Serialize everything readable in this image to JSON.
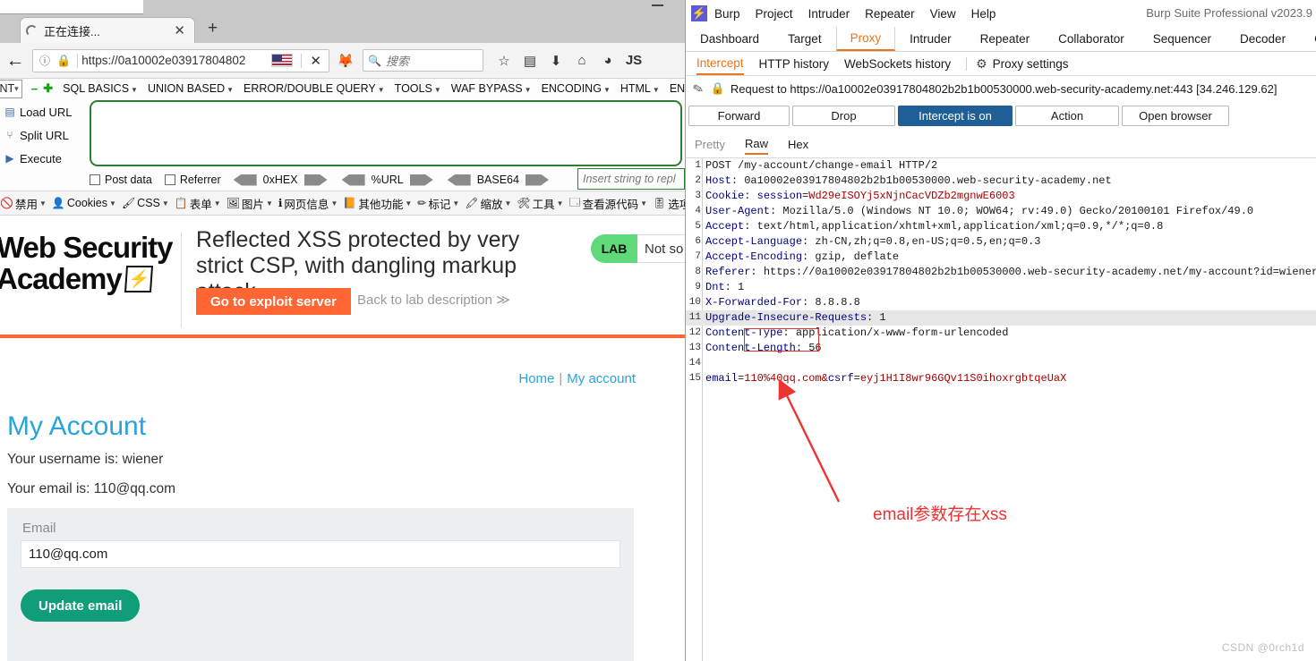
{
  "browser": {
    "tab": {
      "title": "正在连接...",
      "close": "✕",
      "new_tab": "+"
    },
    "url": "https://0a10002e03917804802",
    "search_placeholder": "搜索",
    "icons": [
      "info-icon",
      "lock-icon",
      "flag-us-icon",
      "stop-icon",
      "extension-icon",
      "search-icon",
      "bookmark-star-icon",
      "reader-icon",
      "download-icon",
      "home-icon",
      "account-icon",
      "js-icon"
    ],
    "minimize": "—"
  },
  "hackbar": {
    "select_value": "INT",
    "menus": [
      "SQL BASICS",
      "UNION BASED",
      "ERROR/DOUBLE QUERY",
      "TOOLS",
      "WAF BYPASS",
      "ENCODING",
      "HTML",
      "EN"
    ],
    "actions": [
      "Load URL",
      "Split URL",
      "Execute"
    ],
    "checkboxes": [
      "Post data",
      "Referrer"
    ],
    "pills": [
      "0xHEX",
      "%URL",
      "BASE64"
    ],
    "insert_placeholder": "Insert string to repl",
    "minus": "−",
    "plus": "✚"
  },
  "webdev_toolbar": {
    "items": [
      {
        "icon": "🚫",
        "label": "禁用"
      },
      {
        "icon": "👤",
        "label": "Cookies"
      },
      {
        "icon": "🖌",
        "label": "CSS"
      },
      {
        "icon": "📋",
        "label": "表单"
      },
      {
        "icon": "🖼",
        "label": "图片"
      },
      {
        "icon": "ℹ",
        "label": "网页信息"
      },
      {
        "icon": "📙",
        "label": "其他功能"
      },
      {
        "icon": "✏",
        "label": "标记"
      },
      {
        "icon": "🔍",
        "label": "缩放"
      },
      {
        "icon": "🛠",
        "label": "工具"
      },
      {
        "icon": "🗔",
        "label": "查看源代码"
      },
      {
        "icon": "🎚",
        "label": "选项"
      }
    ]
  },
  "lab": {
    "logo_line1": "Web Security",
    "logo_line2": "Academy",
    "logo_mark": "⚡",
    "title": "Reflected XSS protected by very strict CSP, with dangling markup attack",
    "exploit_button": "Go to exploit server",
    "back_link": "Back to lab description ≫",
    "badge": "LAB",
    "status": "Not so",
    "nav": {
      "home": "Home",
      "separator": "|",
      "my_account": "My account"
    },
    "page_heading": "My Account",
    "username_line": "Your username is: wiener",
    "email_line": "Your email is: 110@qq.com",
    "form": {
      "label": "Email",
      "value": "110@qq.com",
      "submit": "Update email"
    }
  },
  "burp": {
    "app_title": "Burp Suite Professional v2023.9",
    "menus": [
      "Burp",
      "Project",
      "Intruder",
      "Repeater",
      "View",
      "Help"
    ],
    "tabs": [
      "Dashboard",
      "Target",
      "Proxy",
      "Intruder",
      "Repeater",
      "Collaborator",
      "Sequencer",
      "Decoder",
      "Co"
    ],
    "active_tab": "Proxy",
    "subtabs": [
      "Intercept",
      "HTTP history",
      "WebSockets history"
    ],
    "active_subtab": "Intercept",
    "proxy_settings": "Proxy settings",
    "request_to": "Request to https://0a10002e03917804802b2b1b00530000.web-security-academy.net:443  [34.246.129.62]",
    "buttons": [
      "Forward",
      "Drop",
      "Intercept is on",
      "Action",
      "Open browser"
    ],
    "active_button": "Intercept is on",
    "format_tabs": [
      "Pretty",
      "Raw",
      "Hex"
    ],
    "active_format": "Raw",
    "request_lines": [
      {
        "n": 1,
        "text": "POST /my-account/change-email HTTP/2"
      },
      {
        "n": 2,
        "text": "Host: 0a10002e03917804802b2b1b00530000.web-security-academy.net"
      },
      {
        "n": 3,
        "text": "Cookie: session=Wd29eISOYj5xNjnCacVDZb2mgnwE6003"
      },
      {
        "n": 4,
        "text": "User-Agent: Mozilla/5.0 (Windows NT 10.0; WOW64; rv:49.0) Gecko/20100101 Firefox/49.0"
      },
      {
        "n": 5,
        "text": "Accept: text/html,application/xhtml+xml,application/xml;q=0.9,*/*;q=0.8"
      },
      {
        "n": 6,
        "text": "Accept-Language: zh-CN,zh;q=0.8,en-US;q=0.5,en;q=0.3"
      },
      {
        "n": 7,
        "text": "Accept-Encoding: gzip, deflate"
      },
      {
        "n": 8,
        "text": "Referer: https://0a10002e03917804802b2b1b00530000.web-security-academy.net/my-account?id=wiener"
      },
      {
        "n": 9,
        "text": "Dnt: 1"
      },
      {
        "n": 10,
        "text": "X-Forwarded-For: 8.8.8.8"
      },
      {
        "n": 11,
        "text": "Upgrade-Insecure-Requests: 1"
      },
      {
        "n": 12,
        "text": "Content-Type: application/x-www-form-urlencoded"
      },
      {
        "n": 13,
        "text": "Content-Length: 56"
      },
      {
        "n": 14,
        "text": ""
      },
      {
        "n": 15,
        "text": "email=110%40qq.com&csrf=eyj1H1I8wr96GQv11S0ihoxrgbtqeUaX"
      }
    ],
    "highlighted_line": 11
  },
  "annotation": {
    "text": "email参数存在xss",
    "color": "#f03030"
  },
  "watermark": "CSDN @0rch1d",
  "colors": {
    "accent_orange": "#ff6633",
    "burp_orange": "#e8761a",
    "lab_blue": "#29a3dd",
    "green_button": "#0f9d7a",
    "burp_blue": "#1f5f96"
  }
}
